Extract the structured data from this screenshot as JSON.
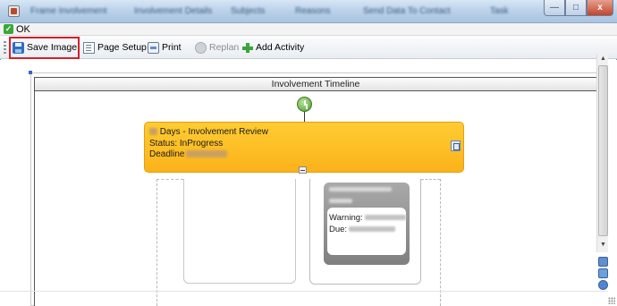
{
  "window": {
    "title_segments": [
      "Involvement Details",
      "Subjects",
      "Reasons",
      "Send Data To Contact"
    ],
    "controls": {
      "close_glyph": "x"
    }
  },
  "ok_bar": {
    "label": "OK"
  },
  "toolbar": {
    "items": [
      {
        "label": "Save Image",
        "icon": "save-icon"
      },
      {
        "label": "Page Setup",
        "icon": "page-setup-icon"
      },
      {
        "label": "Print",
        "icon": "printer-icon"
      },
      {
        "label": "Replan",
        "icon": "replan-icon",
        "disabled": true
      },
      {
        "label": "Add Activity",
        "icon": "add-icon"
      }
    ]
  },
  "timeline": {
    "header": "Involvement Timeline",
    "activity": {
      "line1_suffix": "Days - Involvement Review",
      "status": "Status: InProgress",
      "deadline_label": "Deadline"
    },
    "card": {
      "warning_label": "Warning:",
      "due_label": "Due:"
    }
  },
  "colors": {
    "activity_fill": "#fbb21a",
    "highlight_box": "#d4202a",
    "start_node": "#4e9c2c"
  }
}
